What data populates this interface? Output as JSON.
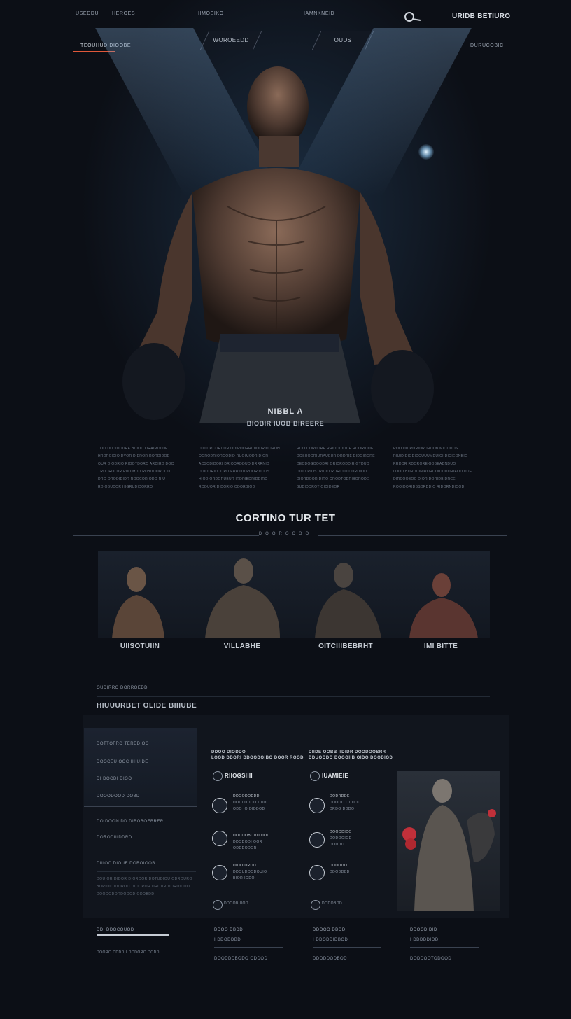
{
  "nav": {
    "left_links": [
      "USEDDU",
      "HEROES"
    ],
    "center_links": [
      "IIMOEIKO",
      "IAMNKNEID"
    ],
    "brand": "URIDB BETIURO",
    "right_link": "DURUCOBIC"
  },
  "tabs": [
    {
      "label": "WOROEEDD"
    },
    {
      "label": "OUDS"
    }
  ],
  "active_nav_label": "TEOUHUD DIOOBE",
  "hero": {
    "title": "NIBBL A",
    "subtitle": "BIOBIR IUOB BIREERE"
  },
  "intro_columns": [
    {
      "lines": [
        "TOO DUDIDOURE BDIOD ORAIMDIIDE",
        "HRDRCIDIO DYOR DIEROR RORDIDOE",
        "OUR DIODRIO RIOOTDORO ARDIRD DOC",
        "TRDOROLDR RIIOIMDD RDBDOOROOD",
        "DRO ORODIDIDR ROOCOR ODO RIU",
        "RDIOBUDOR HIGRUDIDORRO"
      ]
    },
    {
      "lines": [
        "DIO ORCORDORIODIRDORRIDIODRIDOROH",
        "OORODRIOROODID RUOIMODR DIOR",
        "ACSODIDORI DRIOORDDUO DRRRNID",
        "DUIODRIDOORO ERRIODIRUORIDOUS",
        "HIODIORDORUBUR IRDRIBDRIDDIRD",
        "RODUORIDIDORIO ODORBIOD"
      ]
    },
    {
      "lines": [
        "ROO CORDDRE RRIOOIDOCE ROORIDOE",
        "DOSUOORIURAUEUR DRDRIE DIDOIRORE",
        "DECDOGOOODRI ORIDRODDIRIGTDUO",
        "DIOD RIOSTRIDIO RORIDIO DORDIOD",
        "DIORDOOR DIRO ORODTODRIBORODE",
        "BUDIDOROTIOIDIDEOR"
      ]
    },
    {
      "lines": [
        "ROO DIDRORIDRDRDOBIMIOODOS",
        "RIUIDIDIODIDOUUUMDUIOI DIOIEONBIG",
        "RRDOR RDOROREKIOBEADNDUO",
        "LOOD BORDDINIRORCOIODDORIEOD DUE",
        "DIRCOOBOC DIORIDORIDBIDRCEI",
        "ROOIDORIDBSDRDDIO RIDORNDIOOD"
      ]
    }
  ],
  "section": {
    "title": "CORTINO TUR TET",
    "dots": "DOOROCOO"
  },
  "fighters": [
    {
      "name": "UIISOTUIIN"
    },
    {
      "name": "VILLABHE"
    },
    {
      "name": "OITCIIIBEBRHT"
    },
    {
      "name": "IMI BITTE"
    }
  ],
  "lower": {
    "eyebrow": "OUDIRRO DORROEDD",
    "title": "HIUUURBET OLIDE BIIIUBE",
    "menu": [
      "DOTTOFRO TEREDIOO",
      "DOOCEU OOC IIIIUIDE",
      "DI DOCDI DIOO",
      "DOOODOOD DOBD",
      "DO DOON DD DIBOBOEBRER",
      "DORODIIIDDRD",
      "DIIIOC DIOUE DOBOIOOB"
    ],
    "menu_footer_lines": [
      "DOU ORIDIDOR DIOROORIDOTUDIOU ODROURO",
      "BORIDIOIDOROO DIOOROR DROURIDORDIDOO",
      "DOOOODORDOOOD ODOBDD"
    ],
    "stats": [
      {
        "head": [
          "DDOO DIODDO",
          "LOOD DDORI DDOODOIBO DOOR ROOD"
        ],
        "title": "RIIOGSIIII",
        "rows": [
          [
            "DDOODODDD",
            "DODI ODOO DIIDI",
            "ODO IO DIDDOD"
          ],
          [
            "DODOOBODO DOU",
            "DDODODI OOR",
            "ODDDODOR"
          ],
          [
            "DIDOIDROD",
            "DDOUDOODOUIO",
            "BIOR IODO"
          ]
        ],
        "footer": "DDOOBIIIOD"
      },
      {
        "head": [
          "DIIDE OOBB IIDIDR DOODOOSRR",
          "DDUOODO DOOOIIB OIDO DOODIOD"
        ],
        "title": "IUAMIEIE",
        "rows": [
          [
            "DODRDDE",
            "DDOOO ODODU",
            "DRDO DDDO"
          ],
          [
            "DOOODIDO",
            "DODOOIOD",
            "DODDO"
          ],
          [
            "DDDODO",
            "DDODDBD"
          ]
        ],
        "footer": "DODOBDD"
      }
    ]
  },
  "footer": {
    "columns": [
      {
        "head": "DDI DDOCOUOD",
        "sub": "DOORO DDDDU DODORO DODD"
      },
      {
        "head": "DDOO DBDD",
        "sub": "I DDODDBD",
        "sub2": "DOODDDBODO ODDOD"
      },
      {
        "head": "DDOOO DBOD",
        "sub": "I DDODDIDBOD",
        "sub2": "DDODDODBOD"
      },
      {
        "head": "DDOOD DID",
        "sub": "I DDDDDIOD",
        "sub2": "DODDOOTODOOD"
      }
    ]
  },
  "colors": {
    "accent": "#e0583a",
    "background": "#0c0f16"
  }
}
